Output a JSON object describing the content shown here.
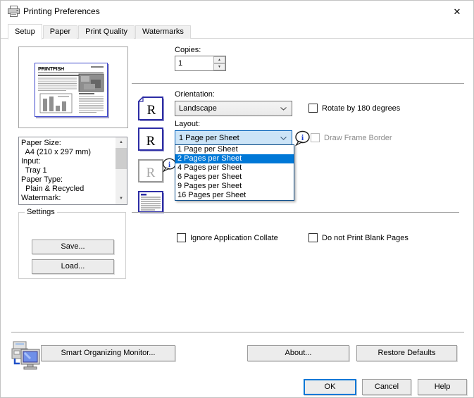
{
  "window": {
    "title": "Printing Preferences",
    "close_glyph": "✕"
  },
  "tabs": [
    "Setup",
    "Paper",
    "Print Quality",
    "Watermarks"
  ],
  "active_tab": 0,
  "preview": {
    "masthead": "PRINTFISH"
  },
  "info_box": {
    "lines": [
      "Paper Size:",
      "  A4 (210 x 297 mm)",
      "Input:",
      "  Tray 1",
      "Paper Type:",
      "  Plain & Recycled",
      "Watermark:"
    ]
  },
  "settings": {
    "group_label": "Settings",
    "save": "Save...",
    "load": "Load..."
  },
  "copies": {
    "label": "Copies:",
    "value": "1"
  },
  "orientation": {
    "label": "Orientation:",
    "value": "Landscape"
  },
  "layout": {
    "label": "Layout:",
    "value": "1 Page per Sheet",
    "options": [
      "1 Page per Sheet",
      "2 Pages per Sheet",
      "4 Pages per Sheet",
      "6 Pages per Sheet",
      "9 Pages per Sheet",
      "16 Pages per Sheet"
    ],
    "selected_index": 1
  },
  "checkboxes": {
    "rotate": {
      "label": "Rotate by 180 degrees",
      "checked": false
    },
    "draw_frame": {
      "label": "Draw Frame Border",
      "checked": false,
      "disabled": true
    },
    "collate": {
      "label": "Ignore Application Collate",
      "checked": false
    },
    "blank_pages": {
      "label": "Do not Print Blank Pages",
      "checked": false
    }
  },
  "buttons": {
    "smart_monitor": "Smart Organizing Monitor...",
    "about": "About...",
    "restore_defaults": "Restore Defaults",
    "ok": "OK",
    "cancel": "Cancel",
    "help": "Help"
  },
  "colors": {
    "accent": "#0078d7",
    "selection_bg": "#0078d7",
    "combo_open_bg": "#cce4f7",
    "icon_border": "#2d2da5"
  }
}
